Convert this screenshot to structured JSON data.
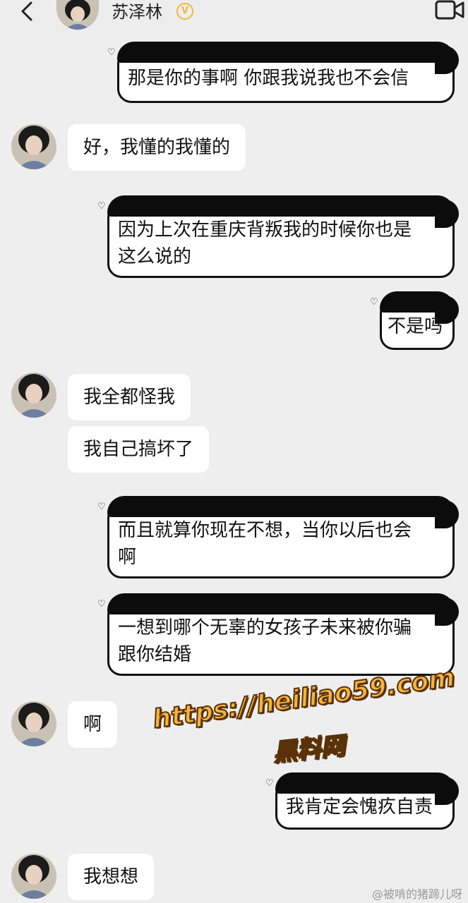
{
  "header": {
    "back_icon": "chevron-left-icon",
    "contact_name": "苏泽林",
    "verified_icon": "verified-badge-icon",
    "verified_mark": "V",
    "video_icon": "video-call-icon"
  },
  "colors": {
    "background": "#eeeeee",
    "bubble": "#ffffff",
    "outgoing_border": "#111111",
    "verified": "#f0b93a",
    "watermark": "#f5b43a"
  },
  "messages": [
    {
      "direction": "outgoing",
      "lines": [
        "那是你的事啊  你跟我说我也不会信"
      ]
    },
    {
      "direction": "incoming",
      "text": "好，我懂的我懂的"
    },
    {
      "direction": "outgoing",
      "lines": [
        "因为上次在重庆背叛我的时候你也是",
        "这么说的"
      ]
    },
    {
      "direction": "outgoing",
      "lines": [
        "不是吗"
      ]
    },
    {
      "direction": "incoming",
      "text": "我全都怪我"
    },
    {
      "direction": "incoming",
      "text": "我自己搞坏了"
    },
    {
      "direction": "outgoing",
      "lines": [
        "而且就算你现在不想，当你以后也会",
        "啊"
      ]
    },
    {
      "direction": "outgoing",
      "lines": [
        "一想到哪个无辜的女孩子未来被你骗",
        "跟你结婚"
      ]
    },
    {
      "direction": "incoming",
      "text": "啊"
    },
    {
      "direction": "outgoing",
      "lines": [
        "我肯定会愧疚自责"
      ]
    },
    {
      "direction": "incoming",
      "text": "我想想"
    }
  ],
  "heart_icon": "♡",
  "watermark": {
    "url": "https://heiliao59.com",
    "name": "黑料网"
  },
  "credit": "@被啃的猪蹄儿呀"
}
